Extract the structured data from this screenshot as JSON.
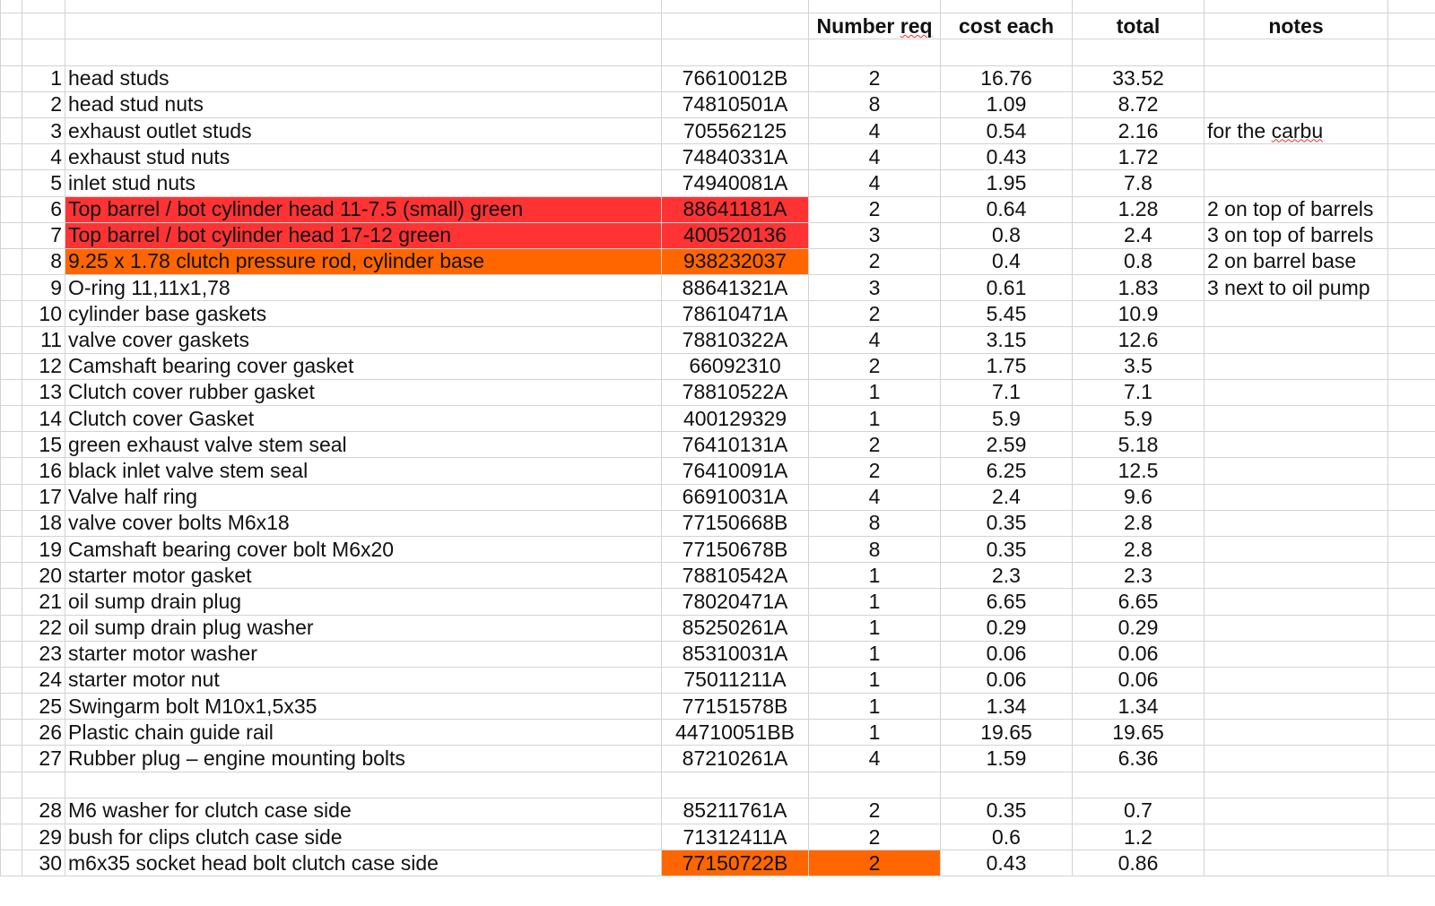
{
  "sheet": {
    "headers": {
      "number_req_a": "Number ",
      "number_req_b": "req",
      "cost_each": "cost each",
      "total": "total",
      "notes": "notes"
    },
    "colors": {
      "red": "#ff3333",
      "orange": "#ff6600"
    },
    "rows": [
      {
        "num": "1",
        "desc": "head studs",
        "part": "76610012B",
        "qty": "2",
        "cost": "16.76",
        "total": "33.52",
        "notes": ""
      },
      {
        "num": "2",
        "desc": "head stud nuts",
        "part": "74810501A",
        "qty": "8",
        "cost": "1.09",
        "total": "8.72",
        "notes": ""
      },
      {
        "num": "3",
        "desc": "exhaust outlet studs",
        "part": "705562125",
        "qty": "4",
        "cost": "0.54",
        "total": "2.16",
        "notes_a": "for the ",
        "notes_b": "carbu"
      },
      {
        "num": "4",
        "desc": "exhaust stud nuts",
        "part": "74840331A",
        "qty": "4",
        "cost": "0.43",
        "total": "1.72",
        "notes": ""
      },
      {
        "num": "5",
        "desc": "inlet stud nuts",
        "part": "74940081A",
        "qty": "4",
        "cost": "1.95",
        "total": "7.8",
        "notes": ""
      },
      {
        "num": "6",
        "desc": "Top barrel / bot cylinder head 11-7.5 (small) green",
        "part": "88641181A",
        "qty": "2",
        "cost": "0.64",
        "total": "1.28",
        "notes": "2 on top of barrels"
      },
      {
        "num": "7",
        "desc": "Top barrel / bot cylinder head 17-12 green",
        "part": "400520136",
        "qty": "3",
        "cost": "0.8",
        "total": "2.4",
        "notes": "3 on top of barrels"
      },
      {
        "num": "8",
        "desc": "9.25 x 1.78 clutch pressure rod, cylinder base",
        "part": "938232037",
        "qty": "2",
        "cost": "0.4",
        "total": "0.8",
        "notes": "2 on barrel base"
      },
      {
        "num": "9",
        "desc": "O-ring 11,11x1,78",
        "part": "88641321A",
        "qty": "3",
        "cost": "0.61",
        "total": "1.83",
        "notes": "3 next to oil pump"
      },
      {
        "num": "10",
        "desc": "cylinder base gaskets",
        "part": "78610471A",
        "qty": "2",
        "cost": "5.45",
        "total": "10.9",
        "notes": ""
      },
      {
        "num": "11",
        "desc": "valve cover gaskets",
        "part": "78810322A",
        "qty": "4",
        "cost": "3.15",
        "total": "12.6",
        "notes": ""
      },
      {
        "num": "12",
        "desc": "Camshaft bearing cover gasket",
        "part": "66092310",
        "qty": "2",
        "cost": "1.75",
        "total": "3.5",
        "notes": ""
      },
      {
        "num": "13",
        "desc": "Clutch cover rubber gasket",
        "part": "78810522A",
        "qty": "1",
        "cost": "7.1",
        "total": "7.1",
        "notes": ""
      },
      {
        "num": "14",
        "desc": "Clutch cover Gasket",
        "part": "400129329",
        "qty": "1",
        "cost": "5.9",
        "total": "5.9",
        "notes": ""
      },
      {
        "num": "15",
        "desc": "green exhaust valve stem seal",
        "part": "76410131A",
        "qty": "2",
        "cost": "2.59",
        "total": "5.18",
        "notes": ""
      },
      {
        "num": "16",
        "desc": "black inlet valve stem seal",
        "part": "76410091A",
        "qty": "2",
        "cost": "6.25",
        "total": "12.5",
        "notes": ""
      },
      {
        "num": "17",
        "desc": "Valve half ring",
        "part": "66910031A",
        "qty": "4",
        "cost": "2.4",
        "total": "9.6",
        "notes": ""
      },
      {
        "num": "18",
        "desc": "valve cover bolts M6x18",
        "part": "77150668B",
        "qty": "8",
        "cost": "0.35",
        "total": "2.8",
        "notes": ""
      },
      {
        "num": "19",
        "desc": "Camshaft bearing cover bolt M6x20",
        "part": "77150678B",
        "qty": "8",
        "cost": "0.35",
        "total": "2.8",
        "notes": ""
      },
      {
        "num": "20",
        "desc": "starter motor gasket",
        "part": "78810542A",
        "qty": "1",
        "cost": "2.3",
        "total": "2.3",
        "notes": ""
      },
      {
        "num": "21",
        "desc": "oil sump drain plug",
        "part": "78020471A",
        "qty": "1",
        "cost": "6.65",
        "total": "6.65",
        "notes": ""
      },
      {
        "num": "22",
        "desc": "oil sump drain plug washer",
        "part": "85250261A",
        "qty": "1",
        "cost": "0.29",
        "total": "0.29",
        "notes": ""
      },
      {
        "num": "23",
        "desc": "starter motor washer",
        "part": "85310031A",
        "qty": "1",
        "cost": "0.06",
        "total": "0.06",
        "notes": ""
      },
      {
        "num": "24",
        "desc": "starter motor nut",
        "part": "75011211A",
        "qty": "1",
        "cost": "0.06",
        "total": "0.06",
        "notes": ""
      },
      {
        "num": "25",
        "desc": "Swingarm bolt M10x1,5x35",
        "part": "77151578B",
        "qty": "1",
        "cost": "1.34",
        "total": "1.34",
        "notes": ""
      },
      {
        "num": "26",
        "desc": "Plastic chain guide rail",
        "part": "44710051BB",
        "qty": "1",
        "cost": "19.65",
        "total": "19.65",
        "notes": ""
      },
      {
        "num": "27",
        "desc": "Rubber plug – engine mounting bolts",
        "part": "87210261A",
        "qty": "4",
        "cost": "1.59",
        "total": "6.36",
        "notes": ""
      },
      {
        "num": "28",
        "desc": "M6 washer for clutch case side",
        "part": "85211761A",
        "qty": "2",
        "cost": "0.35",
        "total": "0.7",
        "notes": ""
      },
      {
        "num": "29",
        "desc": "bush for clips clutch case side",
        "part": "71312411A",
        "qty": "2",
        "cost": "0.6",
        "total": "1.2",
        "notes": ""
      },
      {
        "num": "30",
        "desc": "m6x35 socket head bolt clutch case side",
        "part": "77150722B",
        "qty": "2",
        "cost": "0.43",
        "total": "0.86",
        "notes": ""
      }
    ]
  }
}
